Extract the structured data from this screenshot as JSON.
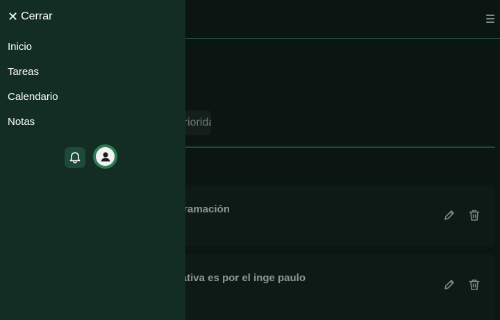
{
  "drawer": {
    "close_label": "Cerrar",
    "close_icon": "close-icon",
    "nav_items": [
      {
        "label": "Inicio"
      },
      {
        "label": "Tareas"
      },
      {
        "label": "Calendario"
      },
      {
        "label": "Notas"
      }
    ],
    "bell_icon": "bell-icon",
    "avatar_icon": "user-avatar-icon"
  },
  "main": {
    "menu_icon": "hamburger-menu-icon",
    "filter_label": "Prioridad",
    "tasks": [
      {
        "title": "Programación"
      },
      {
        "title": "La actividad colaborativa es por el inge paulo"
      }
    ],
    "edit_icon": "pencil-icon",
    "delete_icon": "trash-icon"
  },
  "colors": {
    "background": "#0b1512",
    "drawer": "#132d24",
    "accent": "#1d4a36",
    "avatar_ring": "#2e7d54"
  }
}
